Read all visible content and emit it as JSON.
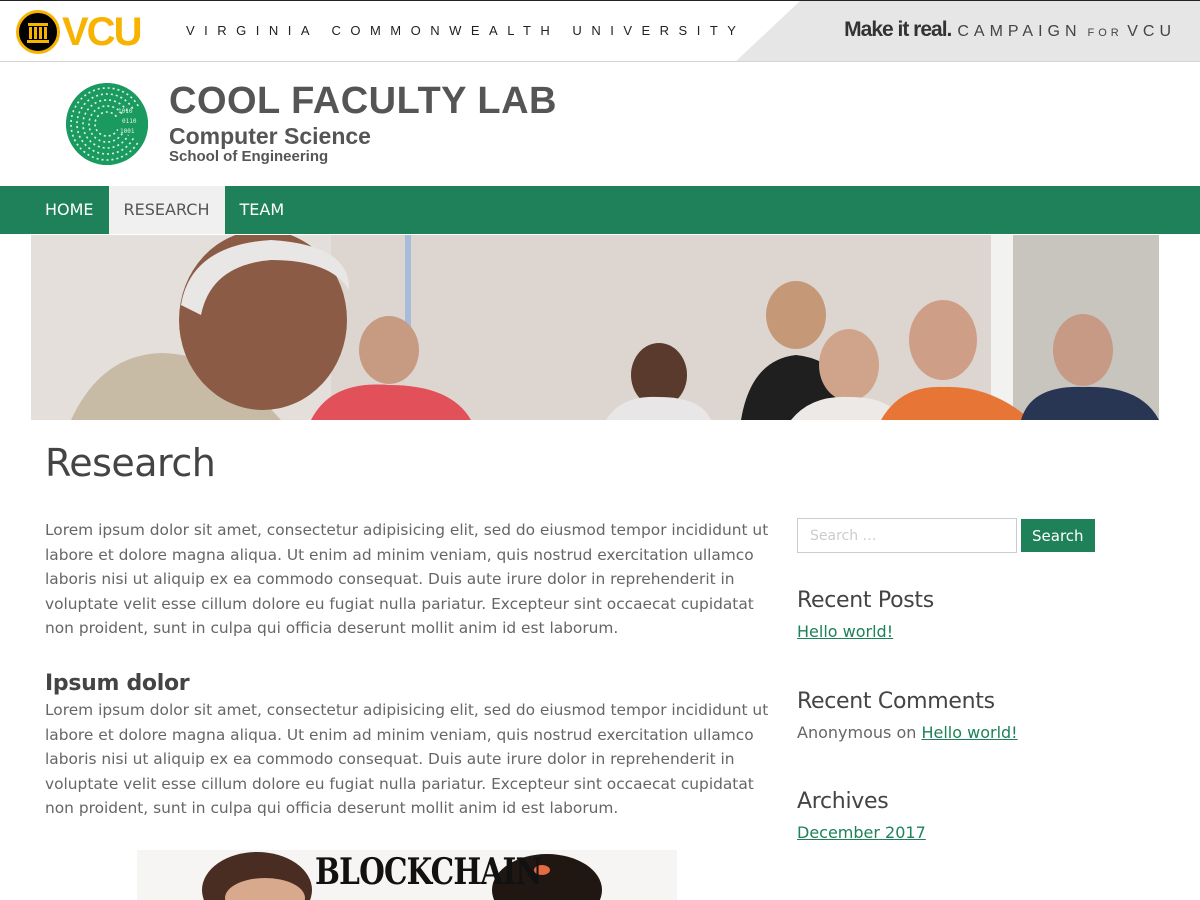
{
  "brand": {
    "logo_text": "VCU",
    "university_name": "VIRGINIA COMMONWEALTH UNIVERSITY",
    "campaign": {
      "tagline": "Make it real.",
      "word_campaign": "CAMPAIGN",
      "word_for": "FOR",
      "word_vcu": "VCU"
    },
    "colors": {
      "gold": "#f8b300",
      "black": "#000000"
    }
  },
  "site": {
    "title": "COOL FACULTY LAB",
    "department": "Computer Science",
    "school": "School of Engineering",
    "accent_color": "#1e8159"
  },
  "nav": {
    "items": [
      {
        "label": "HOME",
        "active": false
      },
      {
        "label": "RESEARCH",
        "active": true
      },
      {
        "label": "TEAM",
        "active": false
      }
    ]
  },
  "page": {
    "title": "Research",
    "paragraph_1": "Lorem ipsum dolor sit amet, consectetur adipisicing elit, sed do eiusmod tempor incididunt ut labore et dolore magna aliqua. Ut enim ad minim veniam, quis nostrud exercitation ullamco laboris nisi ut aliquip ex ea commodo consequat. Duis aute irure dolor in reprehenderit in voluptate velit esse cillum dolore eu fugiat nulla pariatur. Excepteur sint occaecat cupidatat non proident, sunt in culpa qui officia deserunt mollit anim id est laborum.",
    "subheading": "Ipsum dolor",
    "paragraph_2": "Lorem ipsum dolor sit amet, consectetur adipisicing elit, sed do eiusmod tempor incididunt ut labore et dolore magna aliqua. Ut enim ad minim veniam, quis nostrud exercitation ullamco laboris nisi ut aliquip ex ea commodo consequat. Duis aute irure dolor in reprehenderit in voluptate velit esse cillum dolore eu fugiat nulla pariatur. Excepteur sint occaecat cupidatat non proident, sunt in culpa qui officia deserunt mollit anim id est laborum.",
    "image_caption_text": "BLOCKCHAIN"
  },
  "sidebar": {
    "search": {
      "placeholder": "Search …",
      "button_label": "Search"
    },
    "recent_posts": {
      "title": "Recent Posts",
      "link": "Hello world!"
    },
    "recent_comments": {
      "title": "Recent Comments",
      "author": "Anonymous",
      "connector": "on",
      "link": "Hello world!"
    },
    "archives": {
      "title": "Archives",
      "link": "December 2017"
    }
  }
}
